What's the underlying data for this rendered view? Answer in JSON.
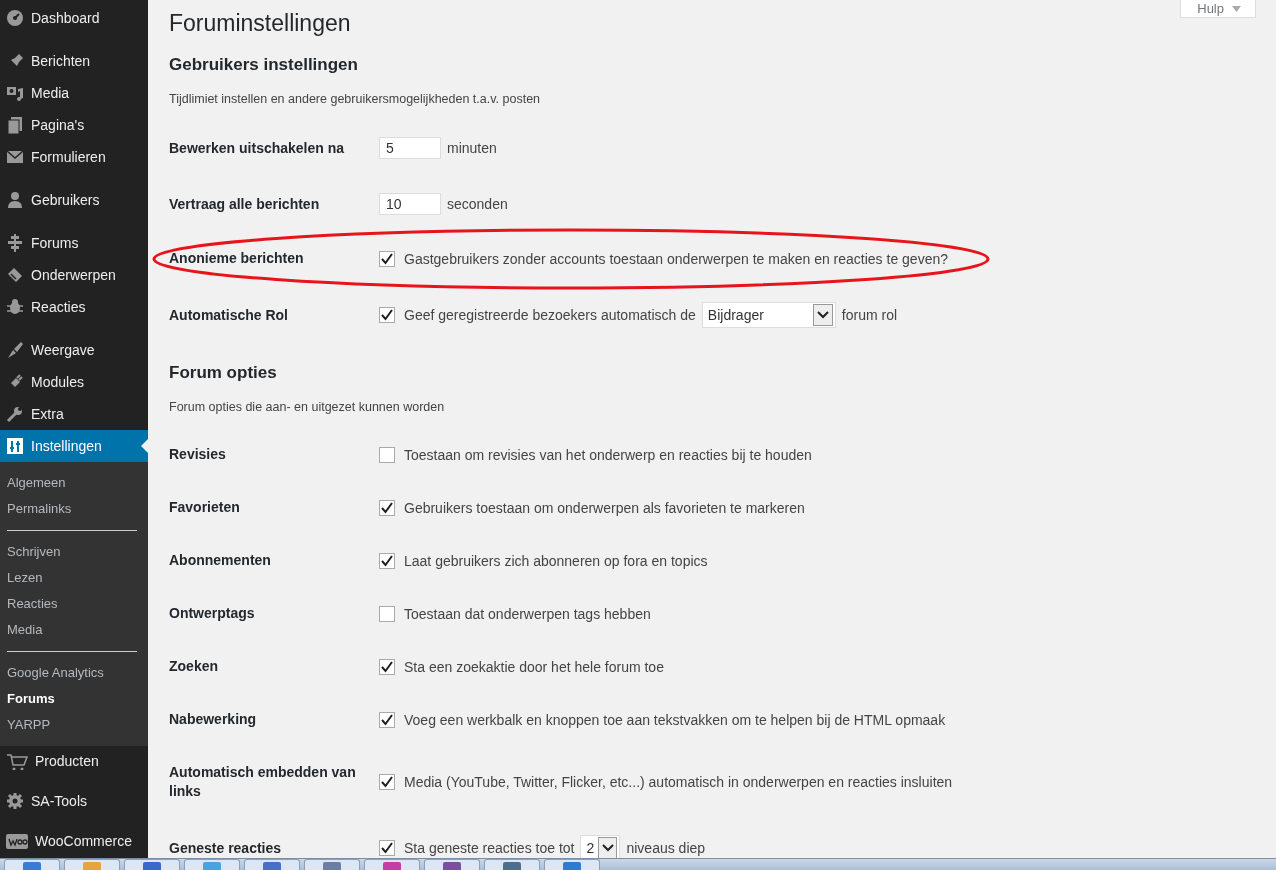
{
  "sidebar": {
    "groups": [
      [
        {
          "label": "Dashboard",
          "selected": false
        }
      ],
      [
        {
          "label": "Berichten",
          "selected": false
        },
        {
          "label": "Media",
          "selected": false
        },
        {
          "label": "Pagina's",
          "selected": false
        },
        {
          "label": "Formulieren",
          "selected": false
        }
      ],
      [
        {
          "label": "Gebruikers",
          "selected": false
        }
      ],
      [
        {
          "label": "Forums",
          "selected": false
        },
        {
          "label": "Onderwerpen",
          "selected": false
        },
        {
          "label": "Reacties",
          "selected": false
        }
      ],
      [
        {
          "label": "Weergave",
          "selected": false
        },
        {
          "label": "Modules",
          "selected": false
        },
        {
          "label": "Extra",
          "selected": false
        },
        {
          "label": "Instellingen",
          "selected": true,
          "submenu": [
            [
              {
                "label": "Algemeen",
                "selected": false
              },
              {
                "label": "Permalinks",
                "selected": false
              }
            ],
            [
              {
                "label": "Schrijven",
                "selected": false
              },
              {
                "label": "Lezen",
                "selected": false
              },
              {
                "label": "Reacties",
                "selected": false
              },
              {
                "label": "Media",
                "selected": false
              }
            ],
            [
              {
                "label": "Google Analytics",
                "selected": false
              },
              {
                "label": "Forums",
                "selected": true
              },
              {
                "label": "YARPP",
                "selected": false
              }
            ]
          ]
        }
      ],
      [
        {
          "label": "Producten",
          "selected": false
        }
      ],
      [
        {
          "label": "SA-Tools",
          "selected": false
        }
      ],
      [
        {
          "label": "WooCommerce",
          "selected": false
        }
      ]
    ]
  },
  "help_button": "Hulp",
  "title": "Foruminstellingen",
  "sections": [
    {
      "heading": "Gebruikers instellingen",
      "description": "Tijdlimiet instellen en andere gebruikersmogelijkheden t.a.v. posten",
      "rows": [
        {
          "kind": "number",
          "label": "Bewerken uitschakelen na",
          "value": "5",
          "unit": "minuten",
          "highlighted": false
        },
        {
          "kind": "number",
          "label": "Vertraag alle berichten",
          "value": "10",
          "unit": "seconden",
          "highlighted": false
        },
        {
          "kind": "checkbox",
          "label": "Anonieme berichten",
          "checked": true,
          "text": "Gastgebruikers zonder accounts toestaan onderwerpen te maken en reacties te geven?",
          "highlighted": true
        },
        {
          "kind": "checkbox_select",
          "label": "Automatische Rol",
          "checked": true,
          "text": "Geef geregistreerde bezoekers automatisch de",
          "select": "Bijdrager",
          "after": "forum rol",
          "highlighted": false
        }
      ]
    },
    {
      "heading": "Forum opties",
      "description": "Forum opties die aan- en uitgezet kunnen worden",
      "rows": [
        {
          "kind": "checkbox",
          "label": "Revisies",
          "checked": false,
          "text": "Toestaan om revisies van het onderwerp en reacties bij te houden",
          "highlighted": false
        },
        {
          "kind": "checkbox",
          "label": "Favorieten",
          "checked": true,
          "text": "Gebruikers toestaan om onderwerpen als favorieten te markeren",
          "highlighted": false
        },
        {
          "kind": "checkbox",
          "label": "Abonnementen",
          "checked": true,
          "text": "Laat gebruikers zich abonneren op fora en topics",
          "highlighted": false
        },
        {
          "kind": "checkbox",
          "label": "Ontwerptags",
          "checked": false,
          "text": "Toestaan dat onderwerpen tags hebben",
          "highlighted": false
        },
        {
          "kind": "checkbox",
          "label": "Zoeken",
          "checked": true,
          "text": "Sta een zoekaktie door het hele forum toe",
          "highlighted": false
        },
        {
          "kind": "checkbox",
          "label": "Nabewerking",
          "checked": true,
          "text": "Voeg een werkbalk en knoppen toe aan tekstvakken om te helpen bij de HTML opmaak",
          "highlighted": false
        },
        {
          "kind": "checkbox",
          "label": "Automatisch embedden van links",
          "checked": true,
          "text": "Media (YouTube, Twitter, Flicker, etc...) automatisch in onderwerpen en reacties insluiten",
          "highlighted": false
        },
        {
          "kind": "checkbox_select",
          "label": "Geneste reacties",
          "checked": true,
          "text": "Sta geneste reacties toe tot",
          "select": "2",
          "after": "niveaus diep",
          "highlighted": false
        }
      ]
    }
  ]
}
